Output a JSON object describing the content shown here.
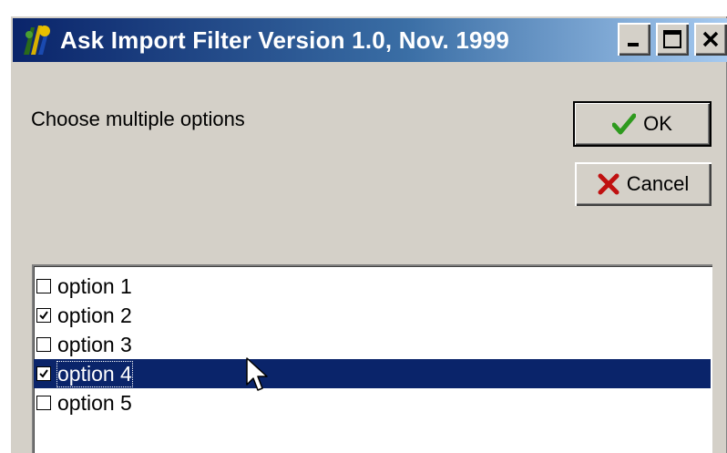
{
  "window": {
    "title": "Ask Import Filter Version 1.0, Nov. 1999",
    "controls": [
      "minimize",
      "maximize",
      "close"
    ]
  },
  "prompt": "Choose multiple options",
  "buttons": {
    "ok_label": "OK",
    "cancel_label": "Cancel"
  },
  "options": [
    {
      "label": "option 1",
      "checked": false,
      "selected": false
    },
    {
      "label": "option 2",
      "checked": true,
      "selected": false
    },
    {
      "label": "option 3",
      "checked": false,
      "selected": false
    },
    {
      "label": "option 4",
      "checked": true,
      "selected": true
    },
    {
      "label": "option 5",
      "checked": false,
      "selected": false
    }
  ],
  "colors": {
    "title_gradient_start": "#0a246a",
    "title_gradient_end": "#a6caf0",
    "face": "#d4d0c8",
    "selection": "#0a246a",
    "ok_check": "#2e9a1e",
    "cancel_x": "#c01010"
  }
}
